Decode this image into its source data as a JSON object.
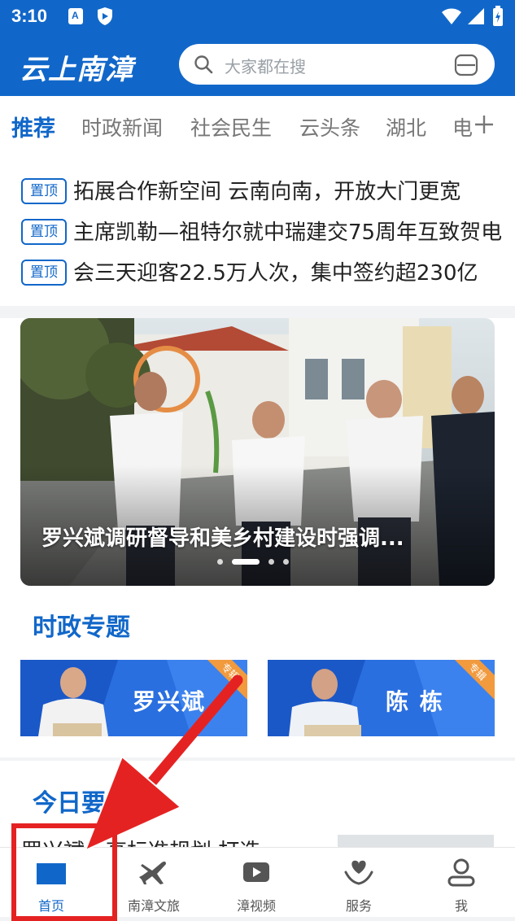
{
  "status_bar": {
    "time": "3:10"
  },
  "header": {
    "brand": "云上南漳",
    "search_placeholder": "大家都在搜"
  },
  "tabs": [
    {
      "label": "推荐",
      "active": true
    },
    {
      "label": "时政新闻"
    },
    {
      "label": "社会民生"
    },
    {
      "label": "云头条"
    },
    {
      "label": "湖北"
    },
    {
      "label": "电"
    }
  ],
  "pinned": [
    {
      "tag": "置顶",
      "title": "拓展合作新空间  云南向南，开放大门更宽"
    },
    {
      "tag": "置顶",
      "title": "主席凯勒—祖特尔就中瑞建交75周年互致贺电"
    },
    {
      "tag": "置顶",
      "title": "会三天迎客22.5万人次，集中签约超230亿"
    }
  ],
  "carousel": {
    "caption": "罗兴斌调研督导和美乡村建设时强调...",
    "dots": 4,
    "active_dot": 1
  },
  "politics_section": {
    "title": "时政专题",
    "topics": [
      {
        "name": "罗兴斌",
        "ribbon": "专辑"
      },
      {
        "name": "陈  栋",
        "ribbon": "专辑"
      }
    ]
  },
  "today_section": {
    "title": "今日要闻",
    "first_headline": "罗兴斌：高标准规划  打造"
  },
  "bottom_nav": [
    {
      "label": "首页",
      "icon": "home-icon",
      "active": true
    },
    {
      "label": "南漳文旅",
      "icon": "plane-icon"
    },
    {
      "label": "漳视频",
      "icon": "video-play-icon"
    },
    {
      "label": "服务",
      "icon": "heart-hand-icon"
    },
    {
      "label": "我",
      "icon": "user-icon"
    }
  ],
  "colors": {
    "brand_blue": "#1167c9",
    "annotation_red": "#e52222"
  }
}
